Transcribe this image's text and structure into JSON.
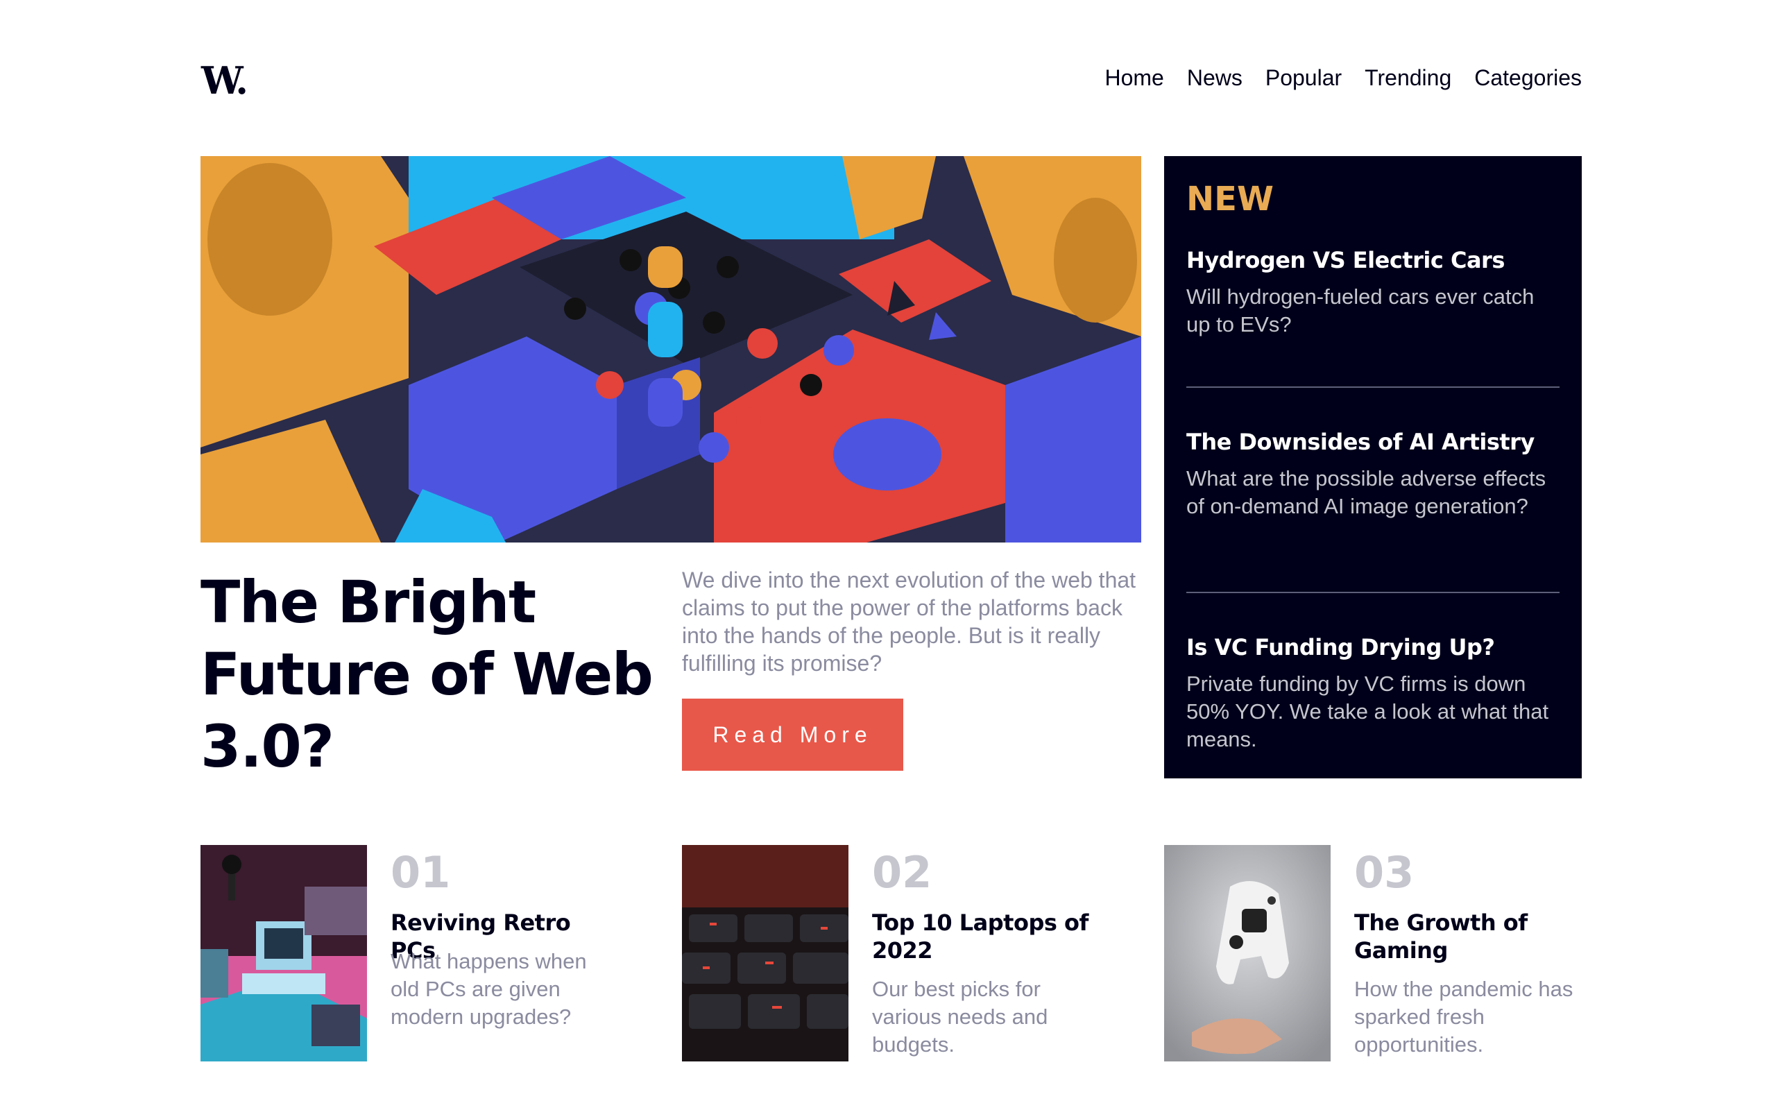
{
  "header": {
    "logo": "W.",
    "nav": [
      "Home",
      "News",
      "Popular",
      "Trending",
      "Categories"
    ]
  },
  "hero": {
    "title": "The Bright Future of Web 3.0?",
    "description": "We dive into the next evolution of the web that claims to put the power of the platforms back into the hands of the people. But is it really fulfilling its promise?",
    "button_label": "Read More"
  },
  "new_panel": {
    "heading": "NEW",
    "items": [
      {
        "title": "Hydrogen VS Electric Cars",
        "description": "Will hydrogen-fueled cars ever catch up to EVs?"
      },
      {
        "title": "The Downsides of AI Artistry",
        "description": "What are the possible adverse effects of on-demand AI image generation?"
      },
      {
        "title": "Is VC Funding Drying Up?",
        "description": "Private funding by VC firms is down 50% YOY. We take a look at what that means."
      }
    ]
  },
  "cards": [
    {
      "number": "01",
      "title": "Reviving Retro PCs",
      "description": "What happens when old PCs are given modern upgrades?"
    },
    {
      "number": "02",
      "title": "Top 10 Laptops of 2022",
      "description": "Our best picks for various needs and budgets."
    },
    {
      "number": "03",
      "title": "The Growth of Gaming",
      "description": "How the pandemic has sparked fresh opportunities."
    }
  ],
  "colors": {
    "dark_navy": "#00001a",
    "soft_red": "#e8584a",
    "soft_orange": "#e9ab53",
    "grayish_blue": "#5d5f79",
    "gray_text": "#8a8b9f"
  }
}
